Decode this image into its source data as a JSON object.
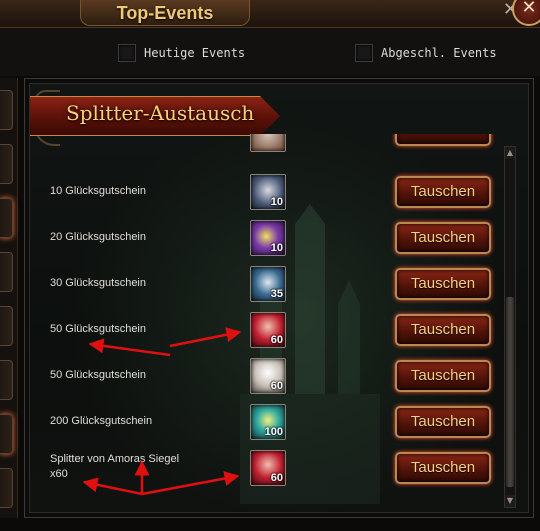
{
  "header": {
    "title": "Top-Events",
    "close_glyph": "✕",
    "cross_glyph": "✕"
  },
  "filters": [
    {
      "label": "Heutige Events",
      "checked": false
    },
    {
      "label": "Abgeschl. Events",
      "checked": false
    }
  ],
  "panel": {
    "title": "Splitter-Austausch"
  },
  "rows": [
    {
      "label": "10 Glücksgutschein",
      "qty": "10",
      "icon": "wolf-helmet-icon",
      "button": "Tauschen"
    },
    {
      "label": "20 Glücksgutschein",
      "qty": "10",
      "icon": "purple-crystal-icon",
      "button": "Tauschen"
    },
    {
      "label": "30 Glücksgutschein",
      "qty": "35",
      "icon": "wolf-helmet-icon",
      "button": "Tauschen"
    },
    {
      "label": "50 Glücksgutschein",
      "qty": "60",
      "icon": "red-portrait-icon",
      "button": "Tauschen"
    },
    {
      "label": "50 Glücksgutschein",
      "qty": "60",
      "icon": "white-portrait-icon",
      "button": "Tauschen"
    },
    {
      "label": "200 Glücksgutschein",
      "qty": "100",
      "icon": "wings-icon",
      "button": "Tauschen"
    },
    {
      "label": "Splitter von Amoras Siegel\nx60",
      "qty": "60",
      "icon": "red-portrait-icon",
      "button": "Tauschen"
    }
  ],
  "colors": {
    "accent_gold": "#f7d27a",
    "button_red": "#8a2614",
    "annotation_red": "#e01010"
  }
}
